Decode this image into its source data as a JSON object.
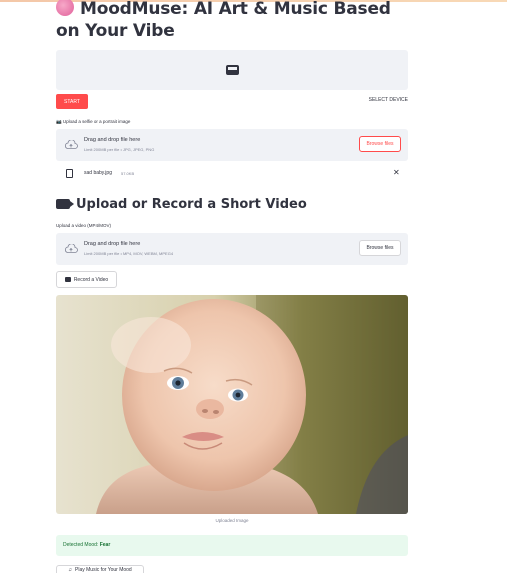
{
  "app": {
    "title": "MoodMuse: AI Art & Music Based on Your Vibe",
    "title_icon": "brain-icon"
  },
  "camera": {
    "icon": "webcam-icon",
    "start_label": "START",
    "select_device_label": "SELECT DEVICE"
  },
  "image_upload": {
    "label": "📷 Upload a selfie or a portrait image",
    "drag_text": "Drag and drop file here",
    "limit_text": "Limit 200MB per file • JPG, JPEG, PNG",
    "browse_label": "Browse files"
  },
  "uploaded_file": {
    "name": "sad baby.jpg",
    "size": "57.0KB",
    "remove_symbol": "✕"
  },
  "video_section": {
    "heading": "Upload or Record a Short Video",
    "upload_label": "Upload a video (MP4/MOV)",
    "drag_text": "Drag and drop file here",
    "limit_text": "Limit 200MB per file • MP4, MOV, WEBM, MPEG4",
    "browse_label": "Browse files",
    "record_label": "Record a Video"
  },
  "image_display": {
    "caption": "Uploaded Image"
  },
  "mood": {
    "prefix": "Detected Mood:",
    "value": "Fear"
  },
  "music": {
    "play_label": "Play Music for Your Mood"
  },
  "colors": {
    "accent": "#ff4b4b",
    "success_bg": "#e8f9ee",
    "success_text": "#177233",
    "panel_bg": "#f0f2f6"
  }
}
